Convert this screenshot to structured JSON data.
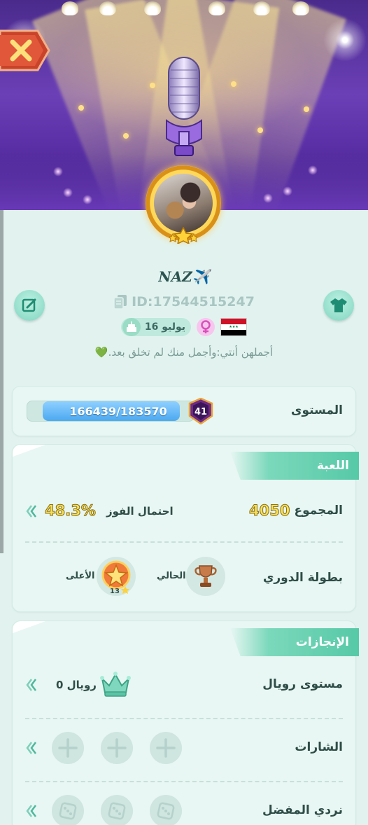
{
  "profile": {
    "username": "NAZ✈️",
    "id": "ID:17544515247",
    "flag": "Iraq",
    "gender": "female",
    "birthday": "16 يوليو",
    "bio": "أجملهن أنتي:وأجمل منك لم تخلق بعد.💚"
  },
  "level": {
    "label": "المستوى",
    "xp": "166439/183570",
    "xp_current": 166439,
    "xp_total": 183570,
    "badge": "41"
  },
  "game": {
    "title": "اللعبة",
    "total_label": "المجموع",
    "total_value": "4050",
    "winrate_label": "احتمال الفوز",
    "winrate_value": "48.3%",
    "league_label": "بطولة الدوري",
    "current_label": "الحالي",
    "highest_label": "الأعلى",
    "highest_rank": "13"
  },
  "achievements": {
    "title": "الإنجازات",
    "royal_label": "مستوى رويال",
    "royal_value": "رويال 0",
    "badges_label": "الشارات",
    "dice_label": "نردي المفضل"
  },
  "colors": {
    "accent": "#56c9a6",
    "background": "#e2f3ef",
    "gold": "#f6e05a",
    "xp_bar": "#4ba9f0"
  },
  "icons": [
    "close-icon",
    "edit-icon",
    "shirt-icon",
    "copy-icon",
    "cake-icon",
    "female-icon",
    "crown-icon",
    "trophy-icon",
    "plus-icon",
    "dice-icon",
    "chevron-left-icon"
  ]
}
